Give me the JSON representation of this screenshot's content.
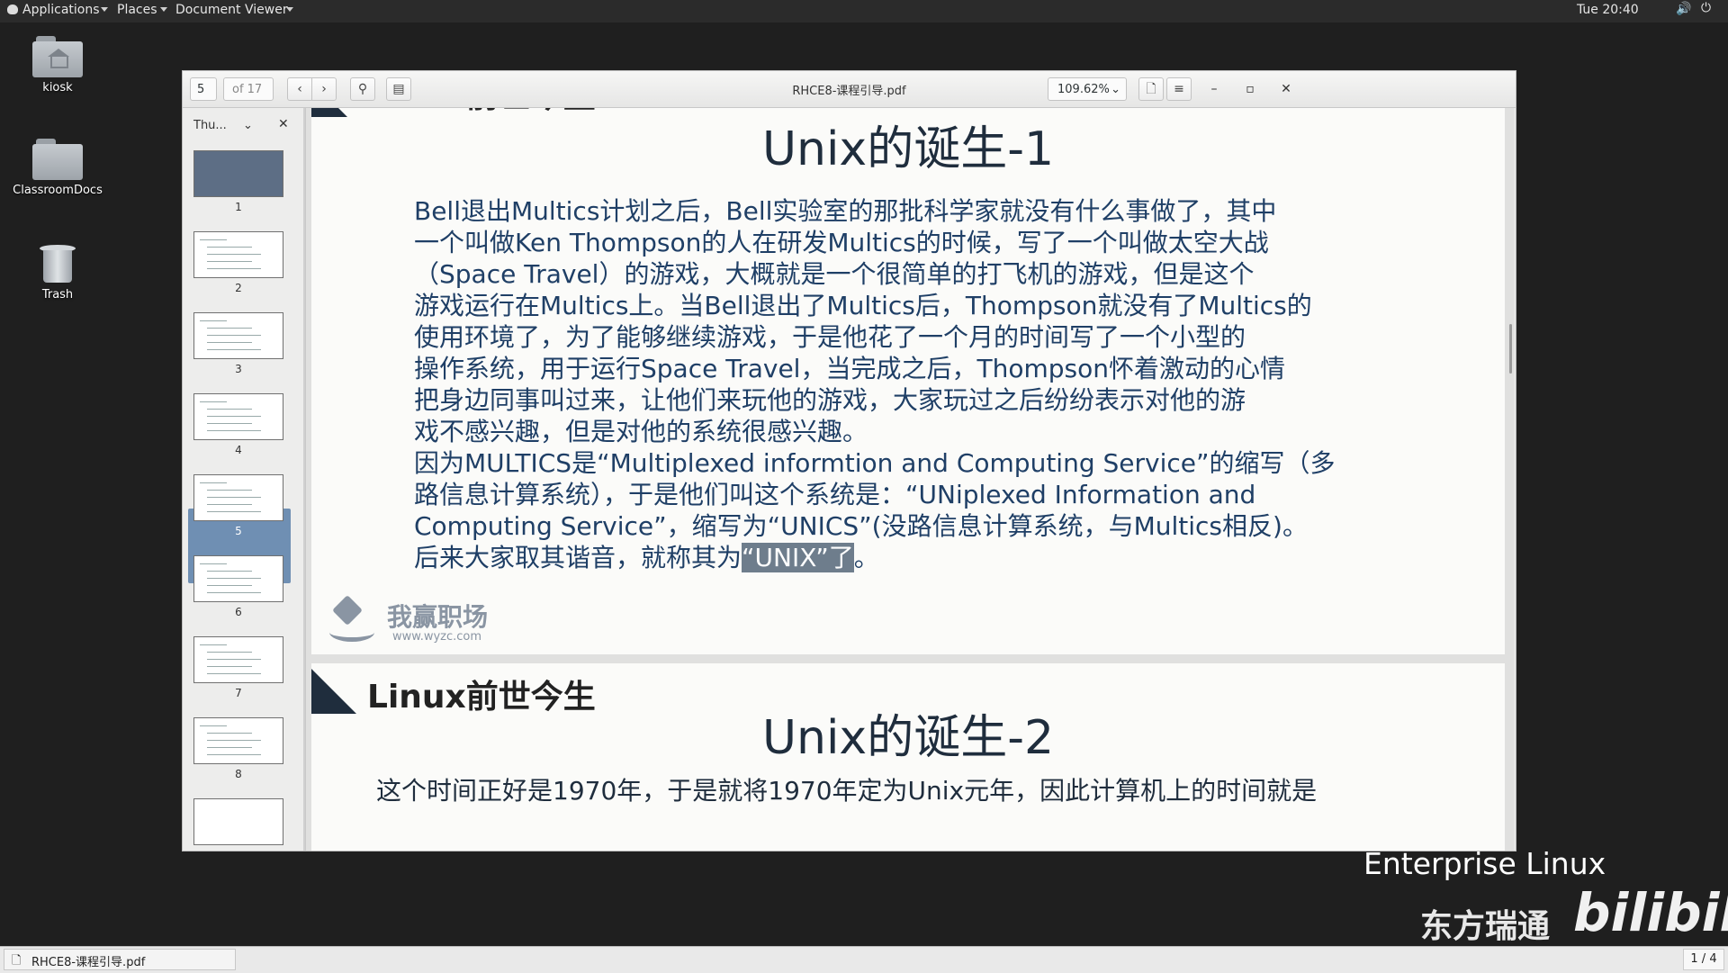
{
  "topbar": {
    "applications": "Applications",
    "places": "Places",
    "app_name": "Document Viewer",
    "clock": "Tue 20:40"
  },
  "desktop": {
    "icons": [
      {
        "label": "kiosk",
        "icon": "home-folder-icon"
      },
      {
        "label": "ClassroomDocs",
        "icon": "folder-icon"
      },
      {
        "label": "Trash",
        "icon": "trash-icon"
      }
    ]
  },
  "viewer": {
    "page_current": "5",
    "page_total": "of 17",
    "doc_title": "RHCE8-课程引导.pdf",
    "zoom": "109.62%",
    "sidebar_mode": "Thu...",
    "thumbnails": [
      "1",
      "2",
      "3",
      "4",
      "5",
      "6",
      "7",
      "8"
    ],
    "selected_thumbnail": "5"
  },
  "slide1": {
    "section": "Linux前世今生",
    "title": "Unix的诞生-1",
    "lines": [
      "Bell退出Multics计划之后，Bell实验室的那批科学家就没有什么事做了，其中",
      "一个叫做Ken Thompson的人在研发Multics的时候，写了一个叫做太空大战",
      "（Space Travel）的游戏，大概就是一个很简单的打飞机的游戏，但是这个",
      "游戏运行在Multics上。当Bell退出了Multics后，Thompson就没有了Multics的",
      "使用环境了，为了能够继续游戏，于是他花了一个月的时间写了一个小型的",
      "操作系统，用于运行Space Travel，当完成之后，Thompson怀着激动的心情",
      "把身边同事叫过来，让他们来玩他的游戏，大家玩过之后纷纷表示对他的游",
      "戏不感兴趣，但是对他的系统很感兴趣。",
      "因为MULTICS是“Multiplexed informtion and Computing Service”的缩写（多",
      "路信息计算系统），于是他们叫这个系统是：“UNiplexed Information and",
      "Computing Service”，缩写为“UNICS”(没路信息计算系统，与Multics相反)。"
    ],
    "last_line_prefix": "后来大家取其谐音，就称其为",
    "last_line_highlight": "“UNIX”了",
    "last_line_suffix": "。",
    "logo_text": "我赢职场",
    "logo_url": "www.wyzc.com"
  },
  "slide2": {
    "section": "Linux前世今生",
    "title": "Unix的诞生-2",
    "line1": "这个时间正好是1970年，于是就将1970年定为Unix元年，因此计算机上的时间就是"
  },
  "watermark": {
    "line1": "Enterprise Linux",
    "line2": "东方瑞通",
    "logo": "bilibili"
  },
  "taskbar": {
    "item": "RHCE8-课程引导.pdf",
    "workspace": "1 / 4"
  }
}
